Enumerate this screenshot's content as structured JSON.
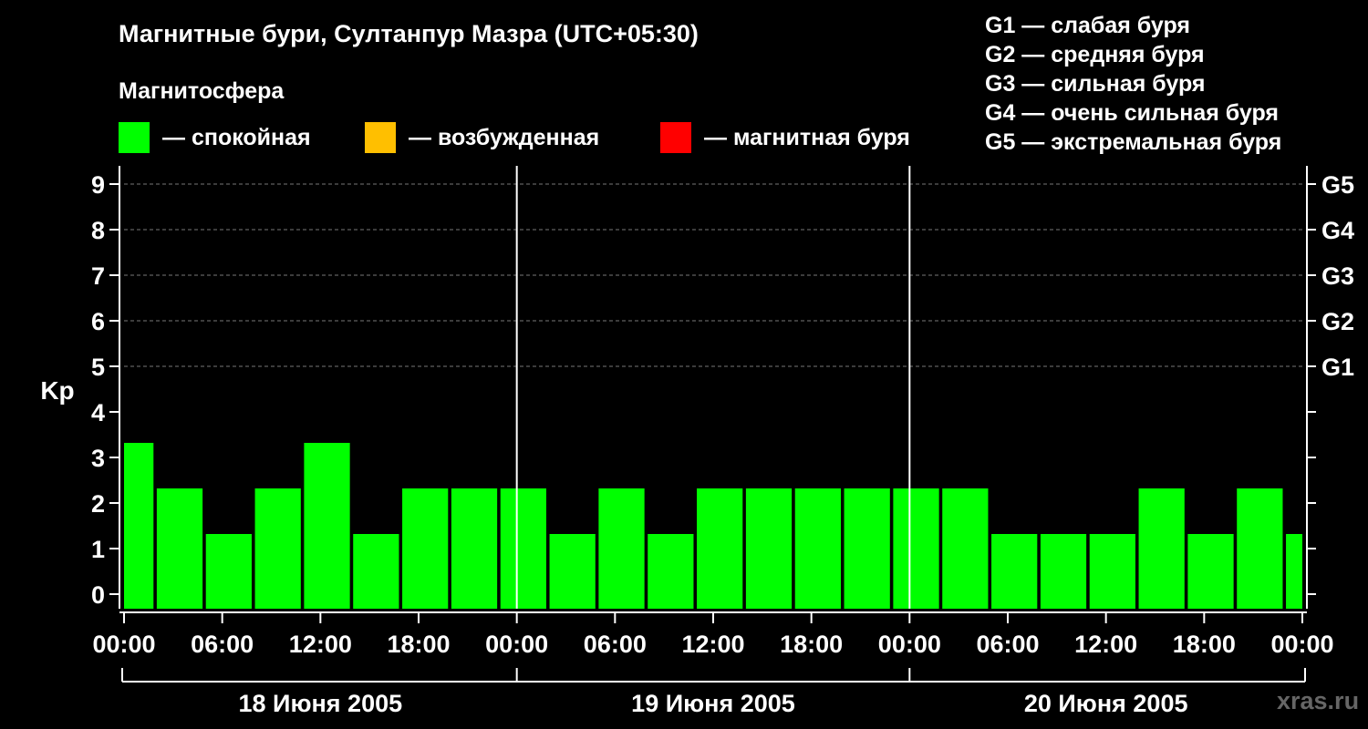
{
  "title": "Магнитные бури, Султанпур Мазра (UTC+05:30)",
  "subtitle": "Магнитосфера",
  "legend": [
    {
      "color": "#00ff00",
      "label": "— спокойная"
    },
    {
      "color": "#ffbf00",
      "label": "— возбужденная"
    },
    {
      "color": "#ff0000",
      "label": "— магнитная буря"
    }
  ],
  "storm_levels": [
    "G1 — слабая буря",
    "G2 — средняя буря",
    "G3 — сильная буря",
    "G4 — очень сильная буря",
    "G5 — экстремальная буря"
  ],
  "watermark": "xras.ru",
  "chart_data": {
    "type": "bar",
    "ylabel": "Kp",
    "ylim": [
      0,
      9
    ],
    "yticks": [
      0,
      1,
      2,
      3,
      4,
      5,
      6,
      7,
      8,
      9
    ],
    "right_ticks": [
      {
        "value": 5,
        "label": "G1"
      },
      {
        "value": 6,
        "label": "G2"
      },
      {
        "value": 7,
        "label": "G3"
      },
      {
        "value": 8,
        "label": "G4"
      },
      {
        "value": 9,
        "label": "G5"
      }
    ],
    "x_range_hours": [
      0,
      72
    ],
    "xtick_hours": [
      0,
      6,
      12,
      18,
      24,
      30,
      36,
      42,
      48,
      54,
      60,
      66,
      72
    ],
    "xtick_labels": [
      "00:00",
      "06:00",
      "12:00",
      "18:00",
      "00:00",
      "06:00",
      "12:00",
      "18:00",
      "00:00",
      "06:00",
      "12:00",
      "18:00",
      "00:00"
    ],
    "days": [
      "18 Июня 2005",
      "19 Июня 2005",
      "20 Июня 2005"
    ],
    "day_boundaries_hours": [
      24,
      48
    ],
    "bar_color": "#00ff00",
    "bars": [
      {
        "start": 0,
        "end": 1.8,
        "kp": 3
      },
      {
        "start": 2,
        "end": 4.8,
        "kp": 2
      },
      {
        "start": 5,
        "end": 7.8,
        "kp": 1
      },
      {
        "start": 8,
        "end": 10.8,
        "kp": 2
      },
      {
        "start": 11,
        "end": 13.8,
        "kp": 3
      },
      {
        "start": 14,
        "end": 16.8,
        "kp": 1
      },
      {
        "start": 17,
        "end": 19.8,
        "kp": 2
      },
      {
        "start": 20,
        "end": 22.8,
        "kp": 2
      },
      {
        "start": 23,
        "end": 25.8,
        "kp": 2
      },
      {
        "start": 26,
        "end": 28.8,
        "kp": 1
      },
      {
        "start": 29,
        "end": 31.8,
        "kp": 2
      },
      {
        "start": 32,
        "end": 34.8,
        "kp": 1
      },
      {
        "start": 35,
        "end": 37.8,
        "kp": 2
      },
      {
        "start": 38,
        "end": 40.8,
        "kp": 2
      },
      {
        "start": 41,
        "end": 43.8,
        "kp": 2
      },
      {
        "start": 44,
        "end": 46.8,
        "kp": 2
      },
      {
        "start": 47,
        "end": 49.8,
        "kp": 2
      },
      {
        "start": 50,
        "end": 52.8,
        "kp": 2
      },
      {
        "start": 53,
        "end": 55.8,
        "kp": 1
      },
      {
        "start": 56,
        "end": 58.8,
        "kp": 1
      },
      {
        "start": 59,
        "end": 61.8,
        "kp": 1
      },
      {
        "start": 62,
        "end": 64.8,
        "kp": 2
      },
      {
        "start": 65,
        "end": 67.8,
        "kp": 1
      },
      {
        "start": 68,
        "end": 70.8,
        "kp": 2
      },
      {
        "start": 71,
        "end": 72,
        "kp": 1
      }
    ]
  }
}
